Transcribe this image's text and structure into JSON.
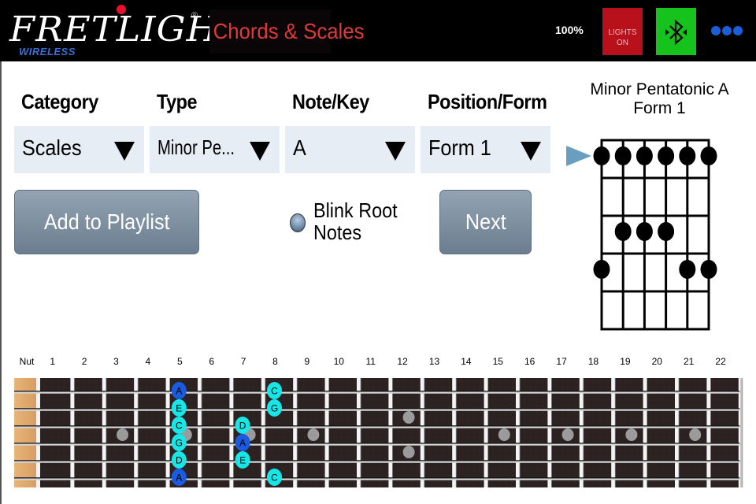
{
  "header": {
    "logo_text": "FRETLIGHT",
    "logo_sub": "WIRELESS",
    "logo_reg": "®",
    "app_title": "Chords & Scales",
    "battery": "100%",
    "lights_button": [
      "LIGHTS",
      "ON"
    ],
    "bluetooth_icon": "bluetooth-icon",
    "more_icon": "more-dots-icon"
  },
  "selectors": [
    {
      "label": "Category",
      "value": "Scales"
    },
    {
      "label": "Type",
      "value": "Minor Pe..."
    },
    {
      "label": "Note/Key",
      "value": "A"
    },
    {
      "label": "Position/Form",
      "value": "Form 1"
    }
  ],
  "buttons": {
    "add_to_playlist": "Add to Playlist",
    "next": "Next"
  },
  "blink_root": {
    "label_line1": "Blink Root",
    "label_line2": "Notes",
    "checked": false
  },
  "diagram": {
    "title_line1": "Minor Pentatonic A",
    "title_line2": "Form 1",
    "position_marker_fret": 1,
    "dots": [
      {
        "string": 1,
        "fret": 1
      },
      {
        "string": 2,
        "fret": 1
      },
      {
        "string": 3,
        "fret": 1
      },
      {
        "string": 4,
        "fret": 1
      },
      {
        "string": 5,
        "fret": 1
      },
      {
        "string": 6,
        "fret": 1
      },
      {
        "string": 2,
        "fret": 3
      },
      {
        "string": 3,
        "fret": 3
      },
      {
        "string": 4,
        "fret": 3
      },
      {
        "string": 1,
        "fret": 4
      },
      {
        "string": 5,
        "fret": 4
      },
      {
        "string": 6,
        "fret": 4
      }
    ]
  },
  "fretboard": {
    "nut_label": "Nut",
    "fret_labels": [
      "1",
      "2",
      "3",
      "4",
      "5",
      "6",
      "7",
      "8",
      "9",
      "10",
      "11",
      "12",
      "13",
      "14",
      "15",
      "16",
      "17",
      "18",
      "19",
      "20",
      "21",
      "22"
    ],
    "inlays": [
      {
        "fret": 3,
        "string_gap": 3
      },
      {
        "fret": 5,
        "string_gap": 3
      },
      {
        "fret": 7,
        "string_gap": 3
      },
      {
        "fret": 9,
        "string_gap": 3
      },
      {
        "fret": 12,
        "string_gap": 2
      },
      {
        "fret": 12,
        "string_gap": 4
      },
      {
        "fret": 15,
        "string_gap": 3
      },
      {
        "fret": 17,
        "string_gap": 3
      },
      {
        "fret": 19,
        "string_gap": 3
      },
      {
        "fret": 21,
        "string_gap": 3
      }
    ],
    "notes": [
      {
        "string": 1,
        "fret": 5,
        "name": "A",
        "root": true
      },
      {
        "string": 2,
        "fret": 5,
        "name": "E",
        "root": false
      },
      {
        "string": 3,
        "fret": 5,
        "name": "C",
        "root": false
      },
      {
        "string": 4,
        "fret": 5,
        "name": "G",
        "root": false
      },
      {
        "string": 5,
        "fret": 5,
        "name": "D",
        "root": false
      },
      {
        "string": 6,
        "fret": 5,
        "name": "A",
        "root": true
      },
      {
        "string": 1,
        "fret": 8,
        "name": "C",
        "root": false
      },
      {
        "string": 2,
        "fret": 8,
        "name": "G",
        "root": false
      },
      {
        "string": 3,
        "fret": 7,
        "name": "D",
        "root": false
      },
      {
        "string": 4,
        "fret": 7,
        "name": "A",
        "root": true
      },
      {
        "string": 5,
        "fret": 7,
        "name": "E",
        "root": false
      },
      {
        "string": 6,
        "fret": 8,
        "name": "C",
        "root": false
      }
    ],
    "colors": {
      "root": "#1a5be0",
      "note": "#18e6e6"
    }
  }
}
